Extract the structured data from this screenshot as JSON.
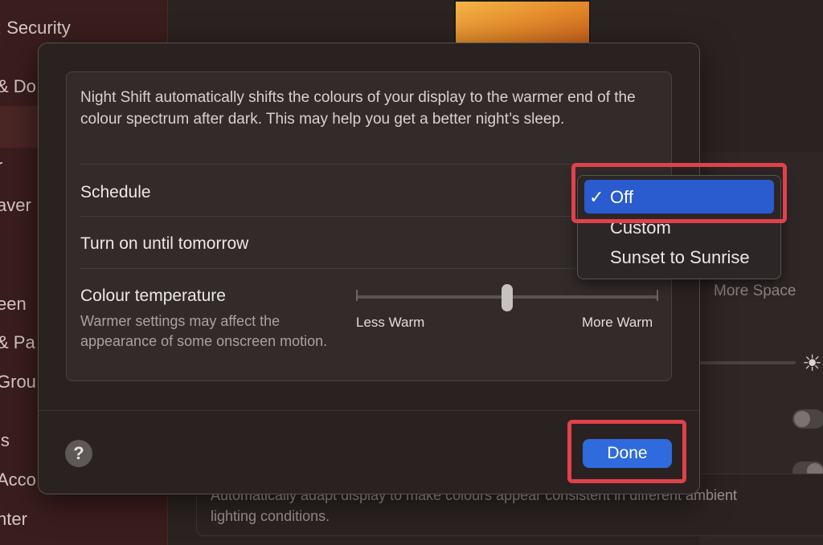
{
  "background": {
    "sidebar_items": [
      {
        "label": ". Security"
      },
      {
        "label": "& Do"
      },
      {
        "label": "r"
      },
      {
        "label": "aver"
      },
      {
        "label": "een"
      },
      {
        "label": "& Pa"
      },
      {
        "label": "Grou"
      },
      {
        "label": "ls"
      },
      {
        "label": "Acco"
      },
      {
        "label": "nter"
      }
    ],
    "more_space_label": "More Space",
    "description": "Automatically adapt display to make colours appear consistent in different ambient lighting conditions."
  },
  "sheet": {
    "intro_text": "Night Shift automatically shifts the colours of your display to the warmer end of the colour spectrum after dark. This may help you get a better night’s sleep.",
    "schedule": {
      "label": "Schedule",
      "options": [
        "Off",
        "Custom",
        "Sunset to Sunrise"
      ],
      "selected": "Off",
      "check_mark": "✓"
    },
    "turn_on_label": "Turn on until tomorrow",
    "colour_temperature": {
      "label": "Colour temperature",
      "subtitle": "Warmer settings may affect the appearance of some onscreen motion.",
      "min_label": "Less Warm",
      "max_label": "More Warm",
      "value_fraction": 0.5
    },
    "help_label": "?",
    "done_label": "Done"
  },
  "colors": {
    "accent": "#2f6bdc",
    "annotation_red": "#e0414b",
    "sheet_bg": "#2a2221"
  }
}
